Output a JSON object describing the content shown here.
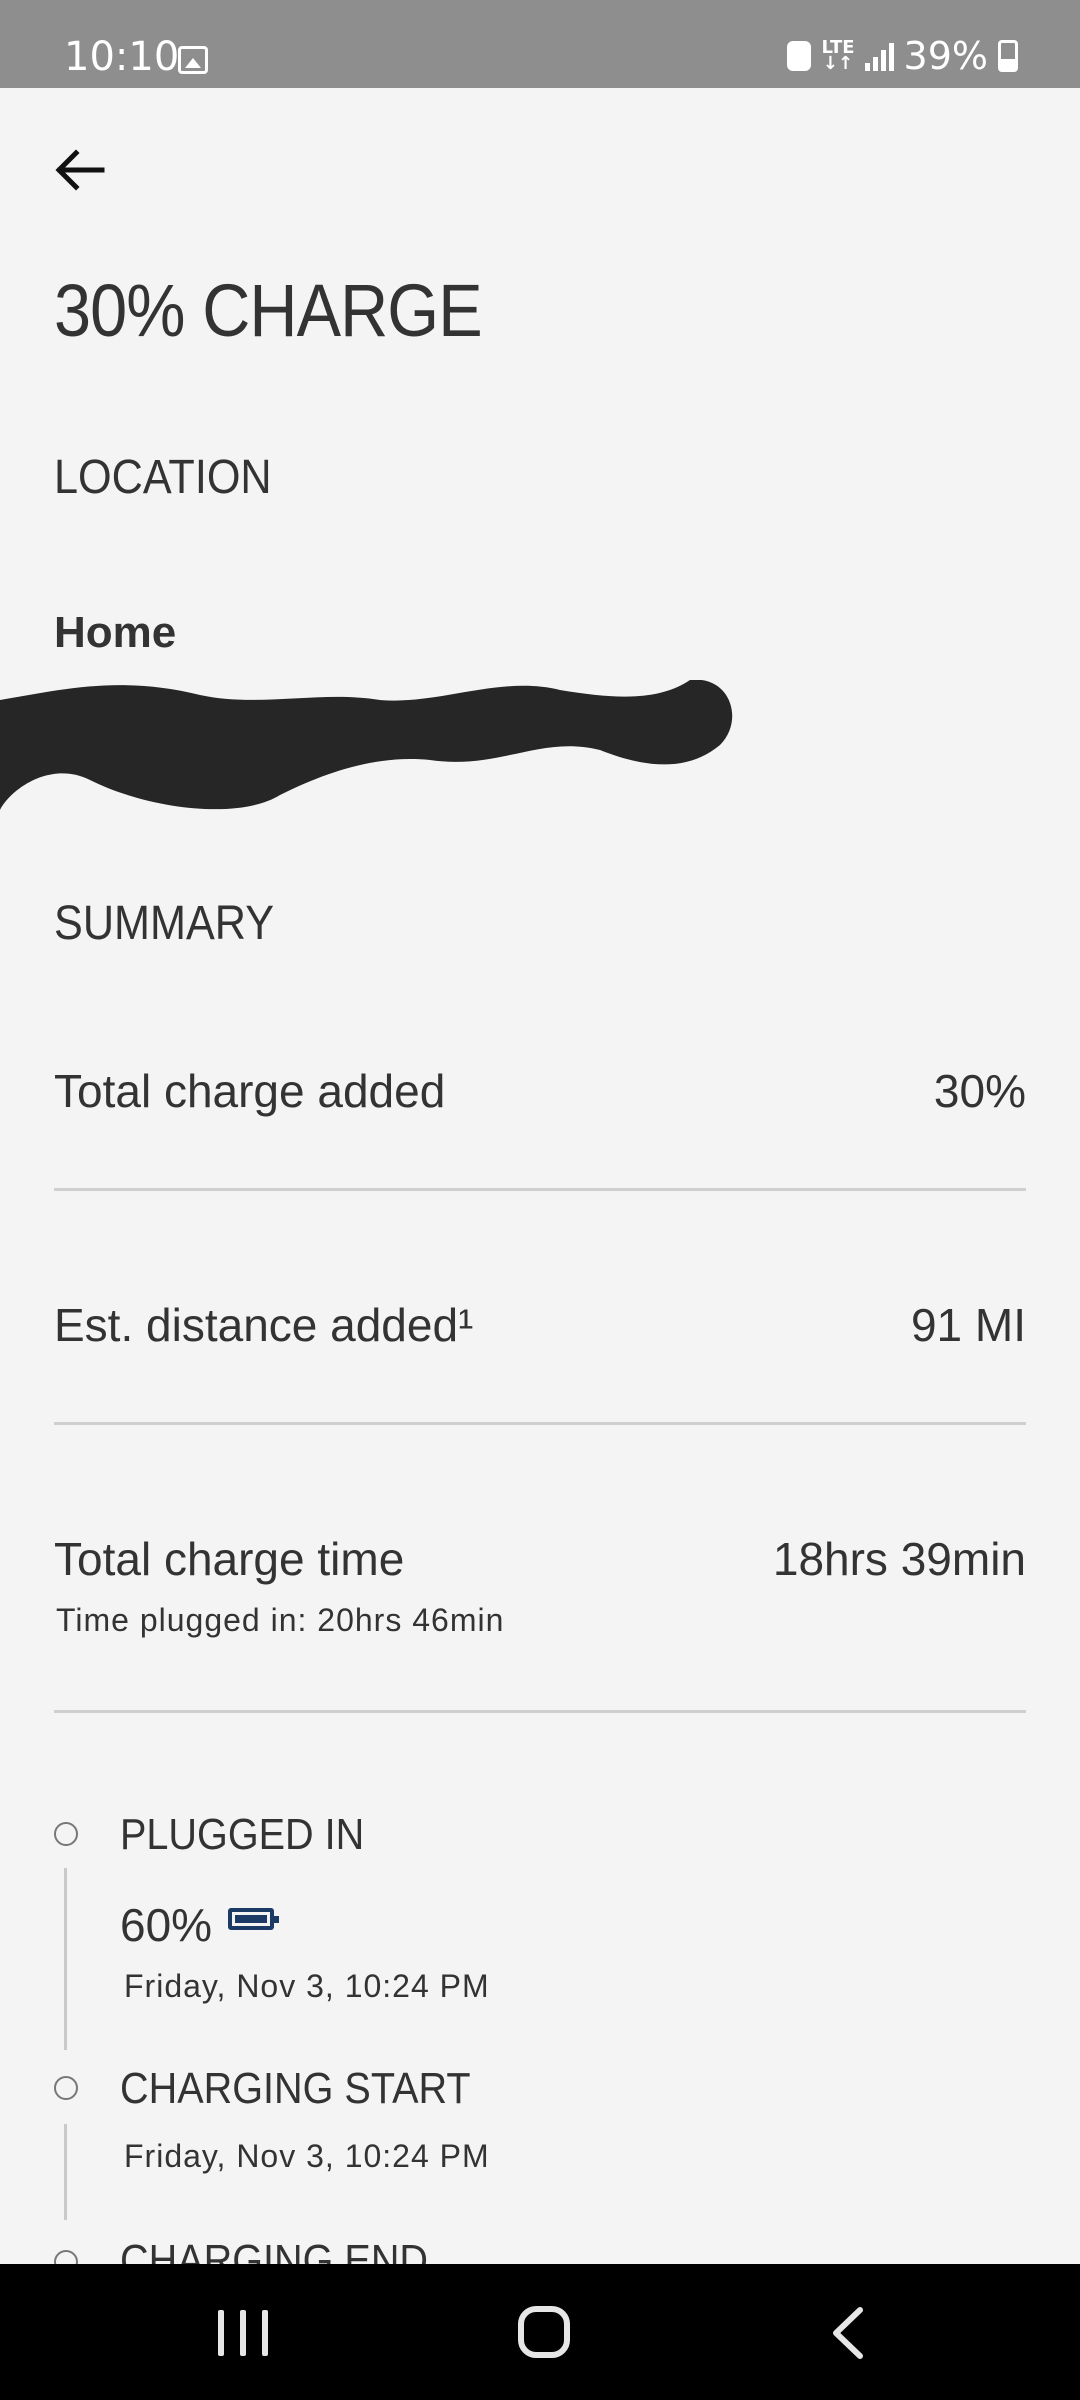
{
  "status_bar": {
    "time": "10:10",
    "network": "LTE",
    "battery": "39%"
  },
  "header": {
    "title": "30% CHARGE"
  },
  "location": {
    "heading": "LOCATION",
    "name": "Home"
  },
  "summary": {
    "heading": "SUMMARY",
    "rows": [
      {
        "label": "Total charge added",
        "value": "30%"
      },
      {
        "label": "Est. distance added¹",
        "value": "91 MI"
      },
      {
        "label": "Total charge time",
        "value": "18hrs 39min",
        "sub": "Time plugged in: 20hrs 46min"
      }
    ]
  },
  "timeline": {
    "events": [
      {
        "title": "PLUGGED IN",
        "percent": "60%",
        "date": "Friday, Nov 3, 10:24 PM"
      },
      {
        "title": "CHARGING START",
        "date": "Friday, Nov 3, 10:24 PM"
      },
      {
        "title": "CHARGING END"
      }
    ]
  },
  "colors": {
    "background": "#f4f4f4",
    "status_bar": "#8e8e8e",
    "battery_icon": "#1c3a66",
    "divider": "#cfcfcf"
  }
}
